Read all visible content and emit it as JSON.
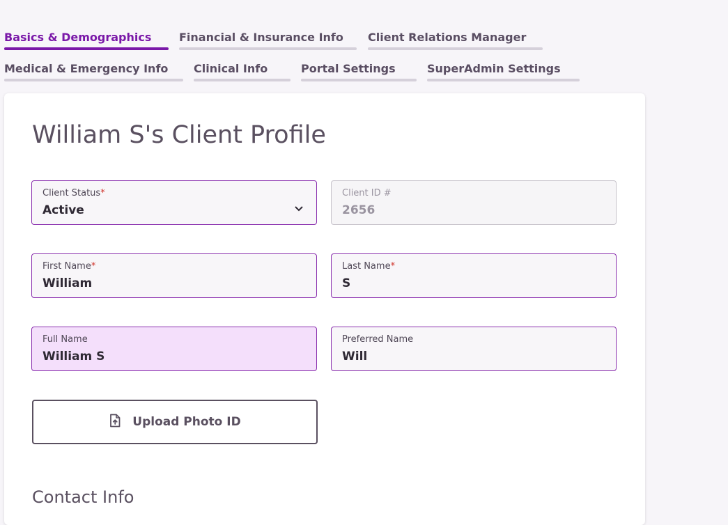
{
  "tabs": {
    "row1": [
      {
        "label": "Basics & Demographics",
        "active": true
      },
      {
        "label": "Financial & Insurance Info",
        "active": false
      },
      {
        "label": "Client Relations Manager",
        "active": false
      }
    ],
    "row2": [
      {
        "label": "Medical & Emergency Info",
        "active": false
      },
      {
        "label": "Clinical Info",
        "active": false
      },
      {
        "label": "Portal Settings",
        "active": false
      },
      {
        "label": "SuperAdmin Settings",
        "active": false
      }
    ]
  },
  "card": {
    "title": "William S's Client Profile",
    "client_status": {
      "label": "Client Status",
      "required_mark": "*",
      "value": "Active"
    },
    "client_id": {
      "label": "Client ID #",
      "value": "2656"
    },
    "first_name": {
      "label": "First Name",
      "required_mark": "*",
      "value": "William"
    },
    "last_name": {
      "label": "Last Name",
      "required_mark": "*",
      "value": "S"
    },
    "full_name": {
      "label": "Full Name",
      "value": "William S"
    },
    "preferred_name": {
      "label": "Preferred Name",
      "value": "Will"
    },
    "upload_button": {
      "label": "Upload Photo ID",
      "icon": "file-upload-icon"
    },
    "contact_section_title": "Contact Info"
  },
  "colors": {
    "accent": "#7a18a8",
    "field_border": "#8a2fae",
    "highlight_bg": "#f4dffb",
    "required": "#d0342c"
  }
}
